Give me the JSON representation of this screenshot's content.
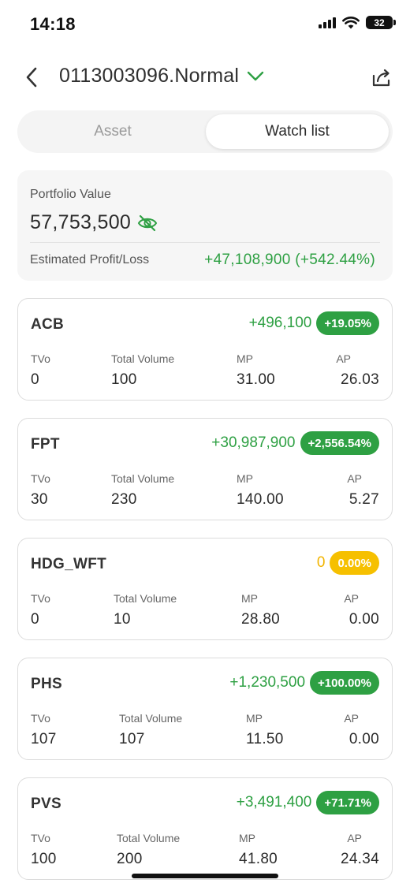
{
  "status_bar": {
    "time": "14:18",
    "battery": "32"
  },
  "header": {
    "account": "0113003096.Normal"
  },
  "tabs": {
    "asset": "Asset",
    "watch_list": "Watch list",
    "active": "watch_list"
  },
  "portfolio": {
    "value_label": "Portfolio Value",
    "value": "57,753,500",
    "pl_label": "Estimated Profit/Loss",
    "pl_value": "+47,108,900 (+542.44%)"
  },
  "column_labels": {
    "tvo": "TVo",
    "total_volume": "Total Volume",
    "mp": "MP",
    "ap": "AP"
  },
  "stocks": [
    {
      "symbol": "ACB",
      "pl": "+496,100",
      "pct": "+19.05%",
      "tvo": "0",
      "total_volume": "100",
      "mp": "31.00",
      "ap": "26.03",
      "status": "up"
    },
    {
      "symbol": "FPT",
      "pl": "+30,987,900",
      "pct": "+2,556.54%",
      "tvo": "30",
      "total_volume": "230",
      "mp": "140.00",
      "ap": "5.27",
      "status": "up"
    },
    {
      "symbol": "HDG_WFT",
      "pl": "0",
      "pct": "0.00%",
      "tvo": "0",
      "total_volume": "10",
      "mp": "28.80",
      "ap": "0.00",
      "status": "neutral"
    },
    {
      "symbol": "PHS",
      "pl": "+1,230,500",
      "pct": "+100.00%",
      "tvo": "107",
      "total_volume": "107",
      "mp": "11.50",
      "ap": "0.00",
      "status": "up"
    },
    {
      "symbol": "PVS",
      "pl": "+3,491,400",
      "pct": "+71.71%",
      "tvo": "100",
      "total_volume": "200",
      "mp": "41.80",
      "ap": "24.34",
      "status": "up"
    }
  ],
  "colors": {
    "positive": "#2ea043",
    "neutral": "#f6c000",
    "text": "#2b2b2b"
  },
  "icons": {
    "back": "chevron-left-icon",
    "dropdown": "chevron-down-icon",
    "share": "share-icon",
    "hide_value": "eye-slash-icon"
  }
}
